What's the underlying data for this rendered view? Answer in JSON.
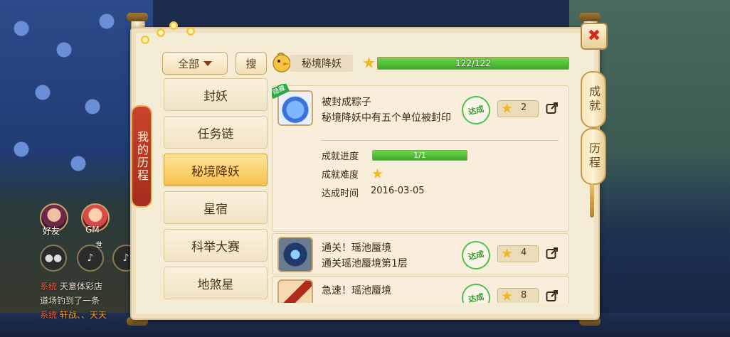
{
  "hud": {
    "friends_label": "好友",
    "gm_label": "GM",
    "mic_label": "世",
    "chat": [
      {
        "tag": "系统",
        "text": "天意体彩店"
      },
      {
        "tag": "",
        "text": "道场钓到了一条"
      },
      {
        "tag": "系统",
        "text": "轩战、、天天"
      }
    ]
  },
  "panel": {
    "side_title": "我的历程",
    "right_tabs": [
      "成就",
      "历程"
    ],
    "close_label": "✖"
  },
  "header": {
    "filter_label": "全部",
    "search_label": "搜",
    "category_title": "秘境降妖",
    "progress_text": "122/122",
    "progress_fraction": 1.0
  },
  "nav": {
    "items": [
      {
        "label": "封妖",
        "active": false
      },
      {
        "label": "任务链",
        "active": false
      },
      {
        "label": "秘境降妖",
        "active": true
      },
      {
        "label": "星宿",
        "active": false
      },
      {
        "label": "科举大赛",
        "active": false
      },
      {
        "label": "地煞星",
        "active": false
      }
    ]
  },
  "achievements": [
    {
      "title": "被封成粽子",
      "desc": "秘境降妖中有五个单位被封印",
      "hidden_tag": "隐藏",
      "stamp": "达成",
      "points": "2",
      "detail": {
        "progress_label": "成就进度",
        "progress_text": "1/1",
        "progress_fraction": 1.0,
        "difficulty_label": "成就难度",
        "difficulty_stars": 1,
        "date_label": "达成时间",
        "date_value": "2016-03-05"
      }
    },
    {
      "title": "通关！瑶池蜃境",
      "desc": "通关瑶池蜃境第1层",
      "stamp": "达成",
      "points": "4"
    },
    {
      "title": "急速！瑶池蜃境",
      "desc": "",
      "stamp": "达成",
      "points": "8"
    }
  ],
  "colors": {
    "accent_red": "#d32a1e",
    "progress_green": "#3da82a",
    "star_gold": "#f2b623",
    "panel_bg": "#f5ecd6"
  }
}
